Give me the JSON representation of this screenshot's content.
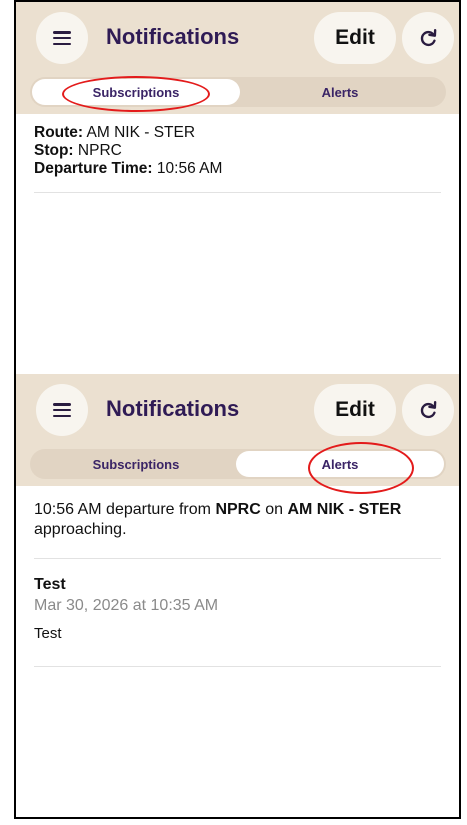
{
  "screen1": {
    "header": {
      "title": "Notifications",
      "edit_label": "Edit"
    },
    "tabs": [
      {
        "label": "Subscriptions",
        "active": true
      },
      {
        "label": "Alerts",
        "active": false
      }
    ],
    "subscription": {
      "route_label": "Route:",
      "route_value": "AM NIK - STER",
      "stop_label": "Stop:",
      "stop_value": "NPRC",
      "departure_label": "Departure Time:",
      "departure_value": "10:56 AM"
    }
  },
  "screen2": {
    "header": {
      "title": "Notifications",
      "edit_label": "Edit"
    },
    "tabs": [
      {
        "label": "Subscriptions",
        "active": false
      },
      {
        "label": "Alerts",
        "active": true
      }
    ],
    "alerts": [
      {
        "part1": "10:56 AM departure from ",
        "stop": "NPRC",
        "part2": " on ",
        "route": "AM NIK - STER",
        "part3": " approaching."
      },
      {
        "title": "Test",
        "date": "Mar 30, 2026 at 10:35 AM",
        "body": "Test"
      }
    ]
  },
  "colors": {
    "header_bg": "#ebe0d0",
    "title": "#2f1b55",
    "highlight_ring": "#e31b1b"
  },
  "icons": {
    "menu": "hamburger-icon",
    "refresh": "refresh-icon"
  }
}
